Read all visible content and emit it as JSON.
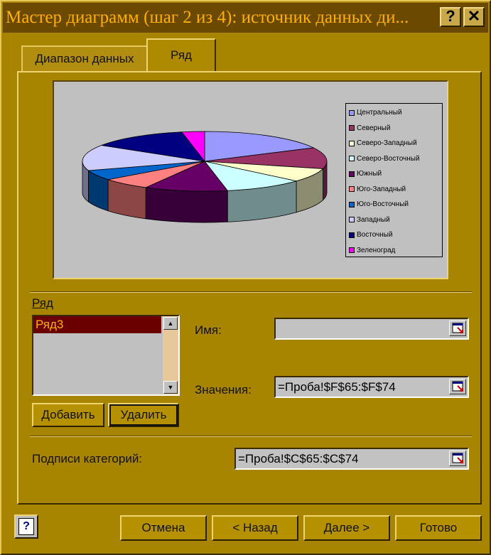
{
  "title": "Мастер диаграмм (шаг 2 из 4): источник данных ди...",
  "title_buttons": {
    "help": "?",
    "close": "✕"
  },
  "tabs": [
    {
      "label": "Диапазон данных",
      "active": false
    },
    {
      "label": "Ряд",
      "active": true
    }
  ],
  "chart_data": {
    "type": "pie",
    "categories": [
      "Центральный",
      "Северный",
      "Северо-Западный",
      "Северо-Восточный",
      "Южный",
      "Юго-Западный",
      "Юго-Восточный",
      "Западный",
      "Восточный",
      "Зеленоград"
    ],
    "legend_placement": "right",
    "colors": [
      "#9999ff",
      "#993366",
      "#ffffcc",
      "#ccffff",
      "#660066",
      "#ff8080",
      "#0066cc",
      "#ccccff",
      "#000080",
      "#ff00ff"
    ]
  },
  "legend_items": [
    "Центральный",
    "Северный",
    "Северо-Западный",
    "Северо-Восточный",
    "Южный",
    "Юго-Западный",
    "Юго-Восточный",
    "Западный",
    "Восточный",
    "Зеленоград"
  ],
  "series_section": {
    "group_label": "Ряд",
    "list_items": [
      "Ряд3"
    ],
    "selected_index": 0,
    "add_button": "Добавить",
    "delete_button": "Удалить",
    "name_label": "Имя:",
    "name_value": "",
    "values_label": "Значения:",
    "values_value": "=Проба!$F$65:$F$74"
  },
  "categories_label": "Подписи категорий:",
  "categories_value": "=Проба!$C$65:$C$74",
  "footer": {
    "help_icon": "?",
    "cancel": "Отмена",
    "back": "< Назад",
    "next": "Далее >",
    "finish": "Готово"
  }
}
